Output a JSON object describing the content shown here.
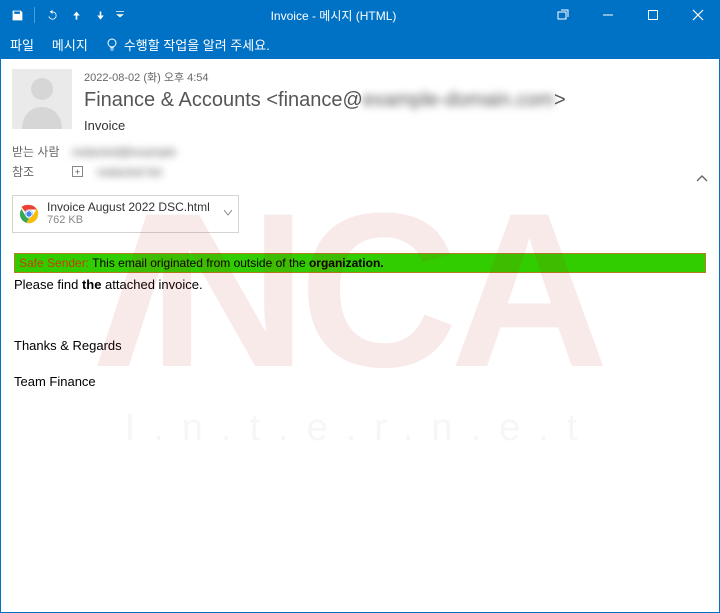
{
  "titlebar": {
    "title": "Invoice - 메시지 (HTML)"
  },
  "ribbon": {
    "file": "파일",
    "message": "메시지",
    "tellme": "수행할 작업을 알려 주세요."
  },
  "header": {
    "date": "2022-08-02 (화) 오후 4:54",
    "from_name": "Finance & Accounts ",
    "from_addr_prefix": "<finance@",
    "from_addr_blurred": "example-domain.com",
    "from_addr_suffix": ">",
    "subject": "Invoice"
  },
  "recipients": {
    "to_label": "받는 사람",
    "to_value": "redacted@example",
    "cc_label": "참조",
    "cc_value": "redacted list"
  },
  "attachment": {
    "name": "Invoice August 2022 DSC.html",
    "size": "762 KB"
  },
  "body": {
    "safe_label": "Safe Sender:",
    "safe_text": " This email originated from outside of the ",
    "safe_bold": "organization.",
    "line1": "Please find the attached invoice.",
    "line2": "Thanks & Regards",
    "line3": "Team Finance"
  },
  "watermark": {
    "big": "INCA",
    "small": "I.n.t.e.r.n.e.t"
  }
}
